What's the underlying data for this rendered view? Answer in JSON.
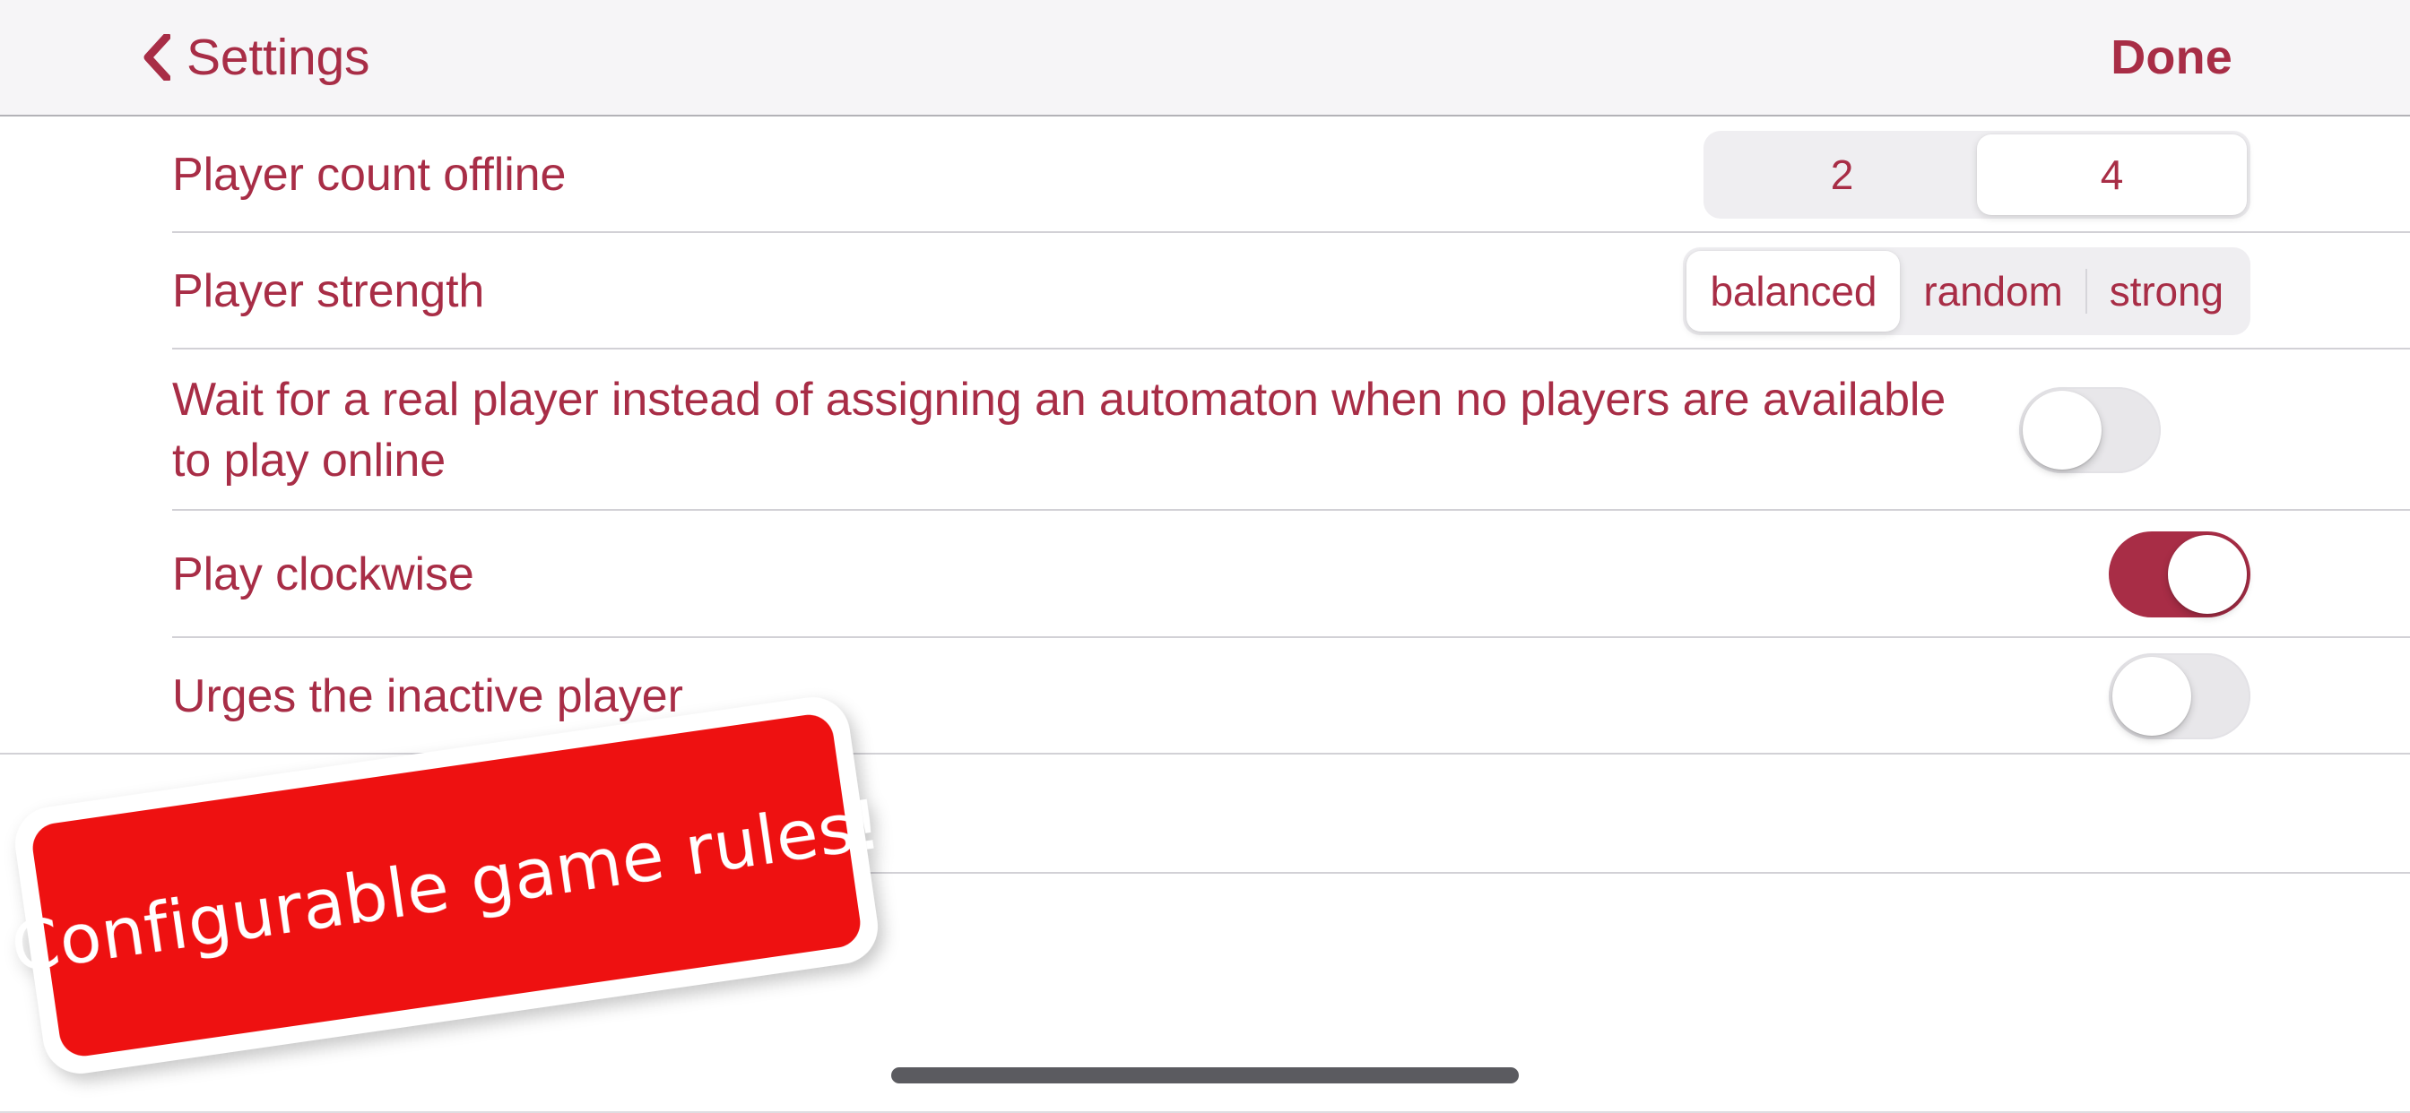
{
  "navbar": {
    "back_label": "Settings",
    "back_icon": "chevron-left-icon",
    "done_label": "Done",
    "accent_color": "#A82D46",
    "background_color": "#F6F5F7"
  },
  "rows": [
    {
      "label": "Player count offline",
      "control": "segmented",
      "options": [
        "2",
        "4"
      ],
      "selected": "4"
    },
    {
      "label": "Player strength",
      "control": "segmented",
      "options": [
        "balanced",
        "random",
        "strong"
      ],
      "selected": "balanced"
    },
    {
      "label": "Wait for a real player instead of assigning an automaton when no players are available to play online",
      "control": "switch",
      "value": "off"
    },
    {
      "label": "Play clockwise",
      "control": "switch",
      "value": "on"
    },
    {
      "label": "Urges the inactive player",
      "control": "switch",
      "value": "off"
    }
  ],
  "sticker": {
    "text": "Configurable game rules!",
    "background_color": "#EE1111",
    "text_color": "#FFFFFF"
  },
  "home_indicator": {
    "name": "home-indicator",
    "color": "#5B5B60"
  }
}
